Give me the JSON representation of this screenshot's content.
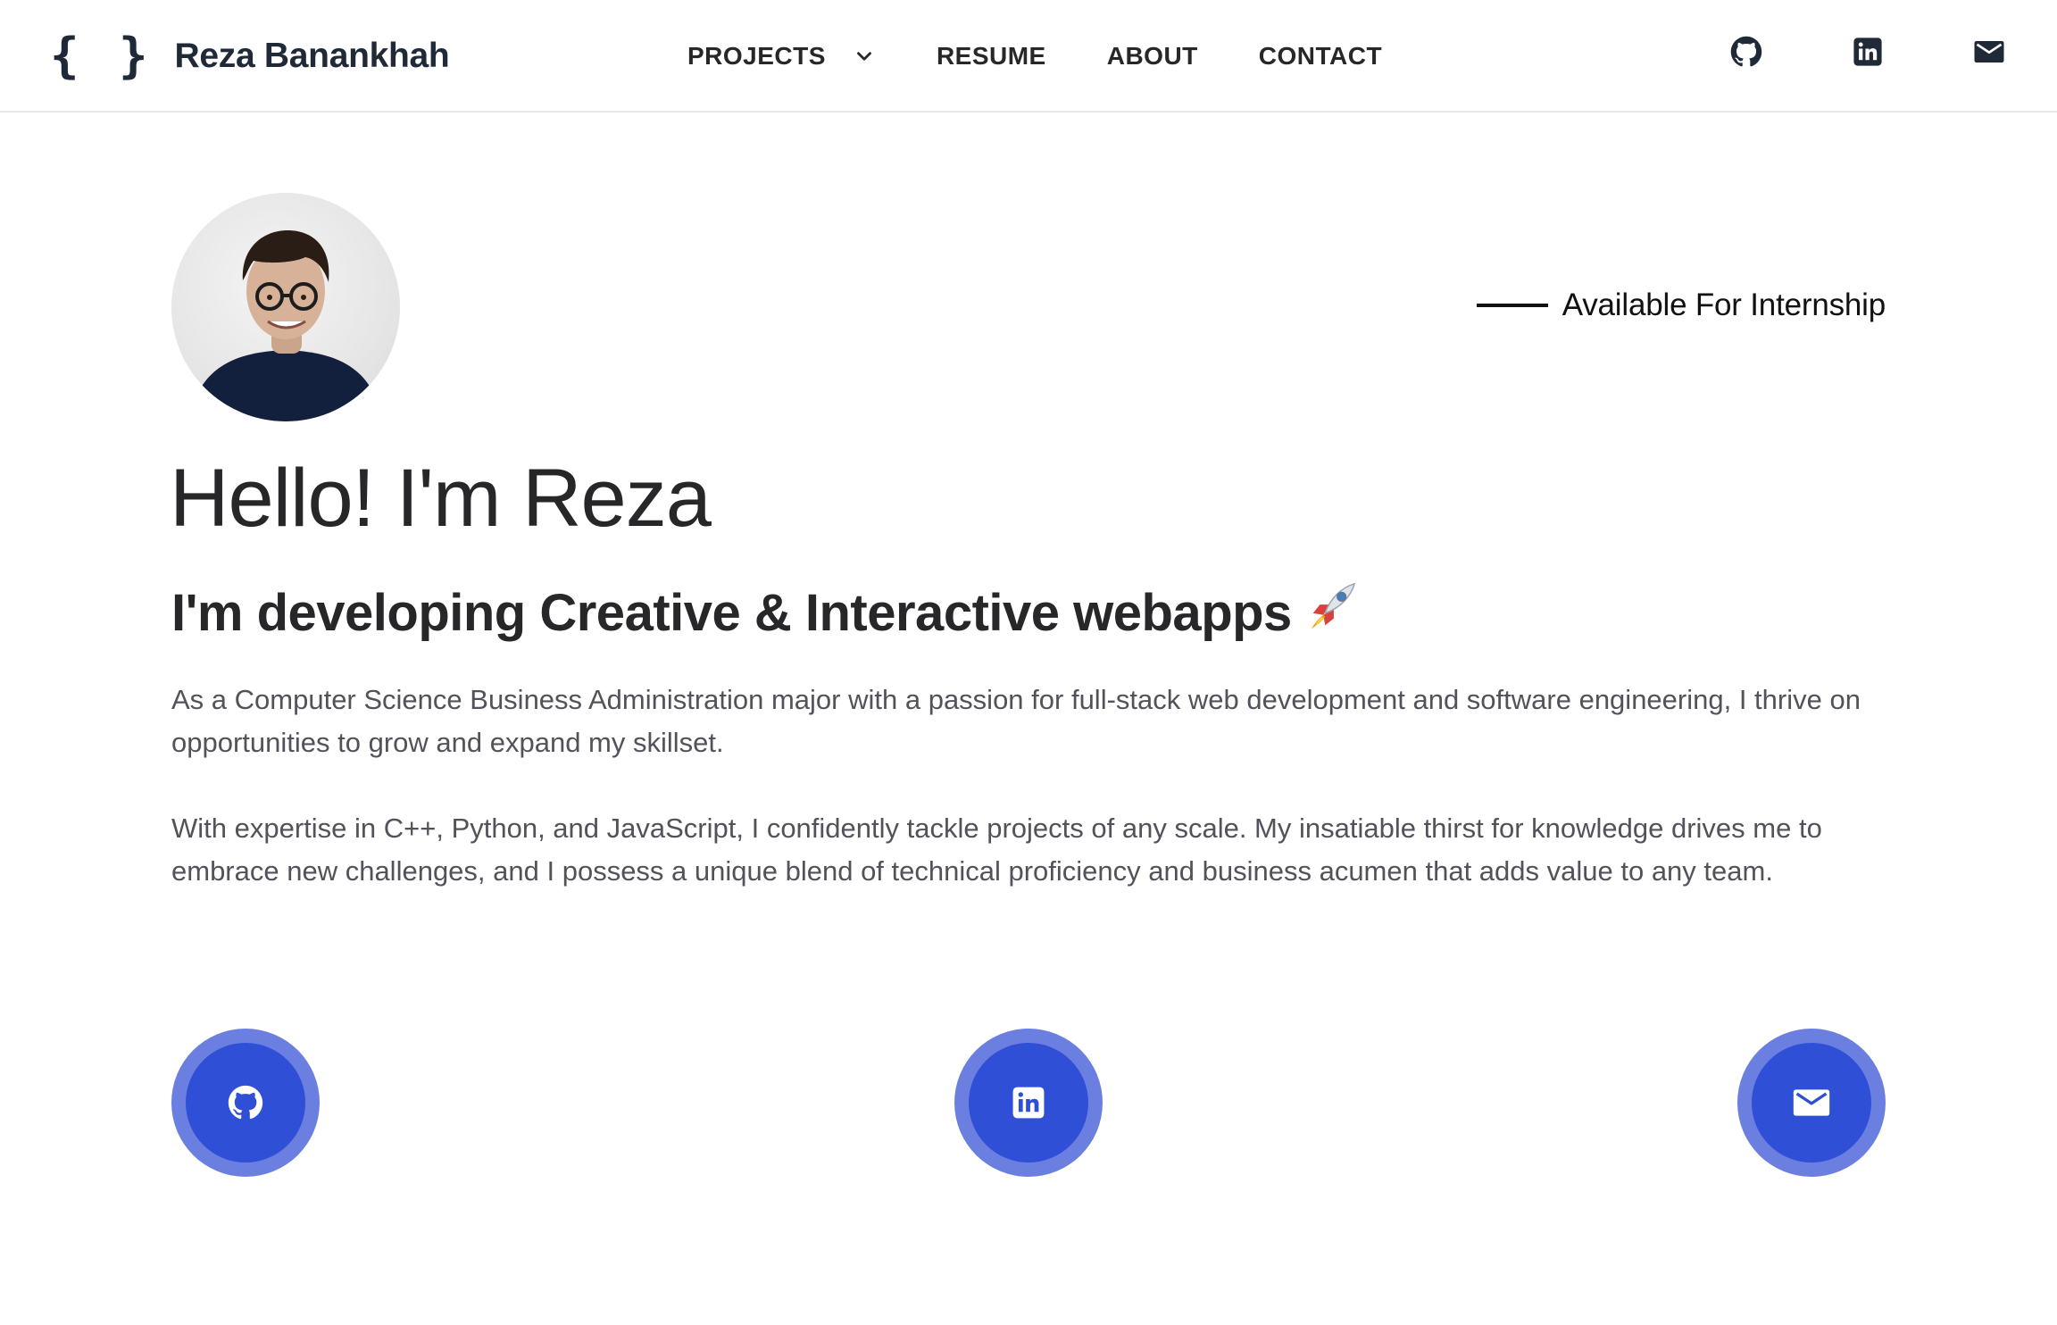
{
  "header": {
    "brand_braces": "{ }",
    "brand_name": "Reza Banankhah",
    "nav": {
      "projects": "PROJECTS",
      "resume": "RESUME",
      "about": "ABOUT",
      "contact": "CONTACT"
    },
    "icons": [
      "github-icon",
      "linkedin-icon",
      "mail-icon"
    ]
  },
  "hero": {
    "availability": "Available For Internship",
    "title": "Hello! I'm Reza",
    "subtitle": "I'm developing Creative & Interactive webapps",
    "bio_1": "As a Computer Science Business Administration major with a passion for full-stack web development and software engineering, I thrive on opportunities to grow and expand my skillset.",
    "bio_2": "With expertise in C++, Python, and JavaScript, I confidently tackle projects of any scale. My insatiable thirst for knowledge drives me to embrace new challenges, and I possess a unique blend of technical proficiency and business acumen that adds value to any team."
  },
  "social": [
    "github-icon",
    "linkedin-icon",
    "mail-icon"
  ],
  "colors": {
    "accent": "#2f4fd6",
    "accent_ring": "#6b7fe0",
    "text": "#27272a",
    "muted": "#52525b"
  }
}
